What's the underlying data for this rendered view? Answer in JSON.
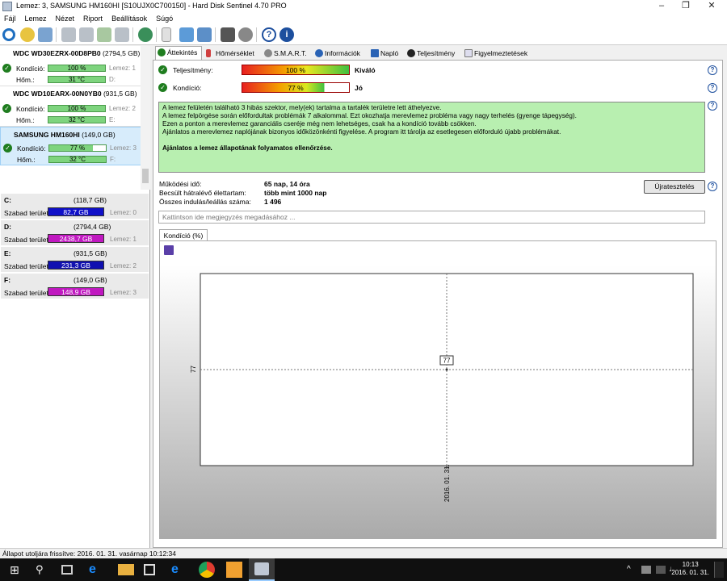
{
  "window": {
    "title": "Lemez: 3, SAMSUNG HM160HI [S10UJX0C700150]  -  Hard Disk Sentinel 4.70 PRO"
  },
  "menu": [
    "Fájl",
    "Lemez",
    "Nézet",
    "Riport",
    "Beállítások",
    "Súgó"
  ],
  "disks": [
    {
      "name": "WDC WD30EZRX-00D8PB0",
      "size": "(2794,5 GB)",
      "health_label": "Kondíció:",
      "health": "100 %",
      "health_value": 100,
      "temp_label": "Hőm.:",
      "temp": "31 °C",
      "disk_ref": "Lemez: 1",
      "drive": "D:"
    },
    {
      "name": "WDC WD10EARX-00N0YB0",
      "size": "(931,5 GB)",
      "health_label": "Kondíció:",
      "health": "100 %",
      "health_value": 100,
      "temp_label": "Hőm.:",
      "temp": "32 °C",
      "disk_ref": "Lemez: 2",
      "drive": "E:"
    },
    {
      "name": "SAMSUNG HM160HI",
      "size": "(149,0 GB)",
      "health_label": "Kondíció:",
      "health": "77 %",
      "health_value": 77,
      "temp_label": "Hőm.:",
      "temp": "32 °C",
      "disk_ref": "Lemez: 3",
      "drive": "F:"
    }
  ],
  "volumes": [
    {
      "name": "C:",
      "size": "(118,7 GB)",
      "free_label": "Szabad terület",
      "free": "82,7 GB",
      "disk_ref": "Lemez: 0",
      "color": "#1010c8"
    },
    {
      "name": "D:",
      "size": "(2794,4 GB)",
      "free_label": "Szabad terület",
      "free": "2438,7 GB",
      "disk_ref": "Lemez: 1",
      "color": "#c018c0"
    },
    {
      "name": "E:",
      "size": "(931,5 GB)",
      "free_label": "Szabad terület",
      "free": "231,3 GB",
      "disk_ref": "Lemez: 2",
      "color": "#1010b0"
    },
    {
      "name": "F:",
      "size": "(149,0 GB)",
      "free_label": "Szabad terület",
      "free": "148,9 GB",
      "disk_ref": "Lemez: 3",
      "color": "#c018c0"
    }
  ],
  "tabs": [
    "Áttekintés",
    "Hőmérséklet",
    "S.M.A.R.T.",
    "Információk",
    "Napló",
    "Teljesítmény",
    "Figyelmeztetések"
  ],
  "overview": {
    "performance_label": "Teljesítmény:",
    "performance": "100 %",
    "performance_value": 100,
    "performance_text": "Kiváló",
    "health_label": "Kondíció:",
    "health": "77 %",
    "health_value": 77,
    "health_text": "Jó",
    "message": [
      "A lemez felületén található 3 hibás szektor, mely(ek) tartalma a tartalék területre lett áthelyezve.",
      "A lemez felpörgése során előfordultak problémák 7 alkalommal. Ezt okozhatja merevlemez probléma vagy nagy terhelés (gyenge tápegység).",
      "Ezen a ponton a merevlemez garanciális cseréje még nem lehetséges, csak ha a kondíció tovább csökken.",
      "Ajánlatos a merevlemez naplójának bizonyos időközönkénti figyelése. A program itt tárolja az esetlegesen előforduló újabb problémákat."
    ],
    "message_bold": "Ajánlatos a lemez állapotának folyamatos ellenőrzése.",
    "uptime_label": "Működési idő:",
    "uptime": "65 nap, 14 óra",
    "remaining_label": "Becsült hátralévő élettartam:",
    "remaining": "több mint 1000 nap",
    "starts_label": "Összes indulás/leállás száma:",
    "starts": "1 496",
    "retest_button": "Újratesztelés",
    "note_placeholder": "Kattintson ide megjegyzés megadásához ...",
    "chart_tab": "Kondíció  (%)"
  },
  "chart_data": {
    "type": "scatter",
    "x": [
      "2016. 01. 31."
    ],
    "values": [
      77
    ],
    "data_labels": [
      "77"
    ],
    "ytick_labels": [
      "77"
    ],
    "xtick_labels": [
      "2016. 01. 31."
    ],
    "title": "",
    "xlabel": "",
    "ylabel": "",
    "grid": true
  },
  "status": "Állapot utoljára frissítve: 2016. 01. 31. vasárnap 10:12:34",
  "taskbar": {
    "time": "10:13",
    "date": "2016. 01. 31."
  }
}
